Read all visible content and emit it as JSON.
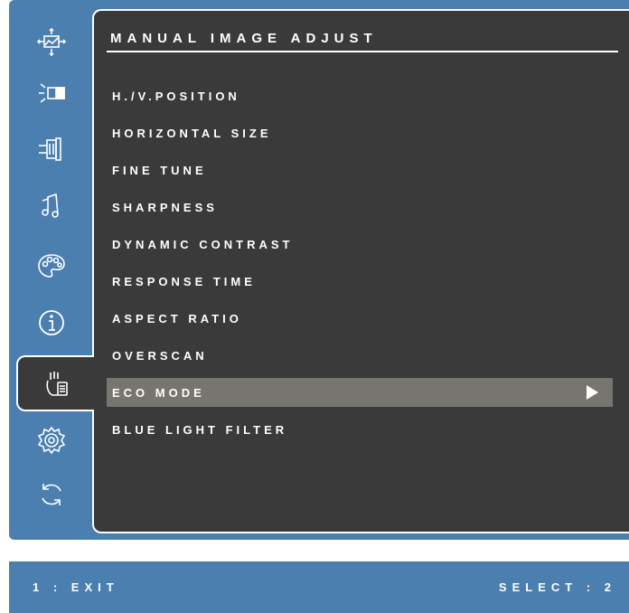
{
  "menu": {
    "title": "MANUAL IMAGE ADJUST",
    "items": [
      {
        "label": "H./V.POSITION"
      },
      {
        "label": "HORIZONTAL SIZE"
      },
      {
        "label": "FINE TUNE"
      },
      {
        "label": "SHARPNESS"
      },
      {
        "label": "DYNAMIC CONTRAST"
      },
      {
        "label": "RESPONSE TIME"
      },
      {
        "label": "ASPECT RATIO"
      },
      {
        "label": "OVERSCAN"
      },
      {
        "label": "ECO MODE",
        "selected": true
      },
      {
        "label": "BLUE LIGHT FILTER"
      }
    ]
  },
  "sidebar": {
    "icons": [
      "auto-adjust-icon",
      "brightness-contrast-icon",
      "input-select-icon",
      "audio-adjust-icon",
      "color-adjust-icon",
      "information-icon",
      "manual-image-adjust-icon",
      "setup-menu-icon",
      "memory-recall-icon"
    ],
    "active": "manual-image-adjust-icon"
  },
  "footer": {
    "exit_label": "1 : EXIT",
    "select_label": "SELECT : 2"
  },
  "colors": {
    "frame": "#4a7fb0",
    "panel": "#3a3a3a",
    "selected_row": "#777570",
    "text": "#ffffff"
  }
}
